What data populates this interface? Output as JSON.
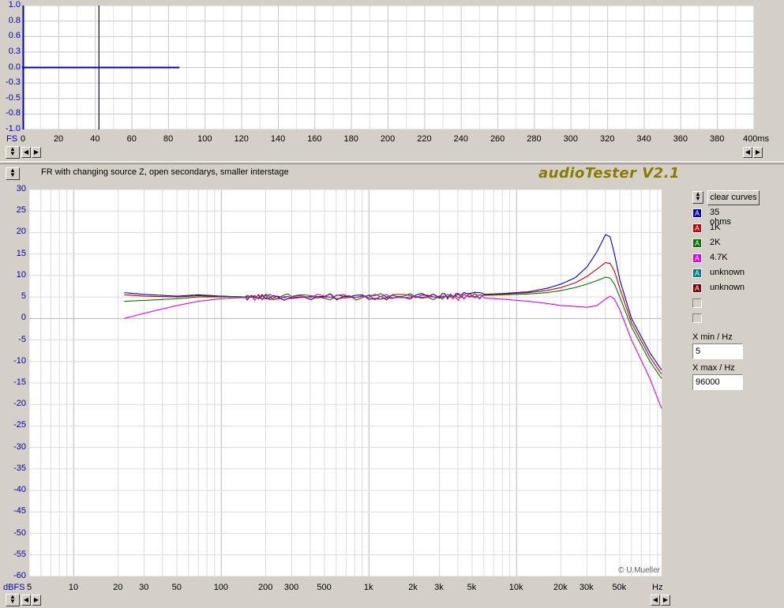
{
  "top_plot": {
    "y_ticks": [
      "1.0",
      "0.8",
      "0.6",
      "0.3",
      "0.0",
      "-0.3",
      "-0.5",
      "-0.8",
      "-1.0"
    ],
    "x_ticks": [
      "0",
      "20",
      "40",
      "60",
      "80",
      "100",
      "120",
      "140",
      "160",
      "180",
      "200",
      "220",
      "240",
      "260",
      "280",
      "300",
      "320",
      "340",
      "360",
      "380",
      "400ms"
    ],
    "y_unit": "FS"
  },
  "graph_title": "FR with changing source Z, open secondarys, smaller interstage",
  "brand": "audioTester V2.1",
  "clear_curves_label": "clear curves",
  "legend": [
    {
      "letter": "A",
      "label": "35 ohms",
      "color": "#0000c8"
    },
    {
      "letter": "A",
      "label": "1K",
      "color": "#c80000"
    },
    {
      "letter": "A",
      "label": "2K",
      "color": "#007800"
    },
    {
      "letter": "A",
      "label": "4.7K",
      "color": "#e000e0"
    },
    {
      "letter": "A",
      "label": "unknown",
      "color": "#008080"
    },
    {
      "letter": "A",
      "label": "unknown",
      "color": "#800000"
    }
  ],
  "xmin_label": "X min / Hz",
  "xmin_value": "5",
  "xmax_label": "X max / Hz",
  "xmax_value": "96000",
  "copyright": "© U.Mueller",
  "chart_data": {
    "type": "line",
    "y_unit": "dBFS",
    "x_unit": "Hz",
    "x_scale": "log",
    "xlim": [
      5,
      96000
    ],
    "ylim": [
      -60,
      30
    ],
    "y_ticks": [
      30,
      25,
      20,
      15,
      10,
      5,
      0,
      -5,
      -10,
      -15,
      -20,
      -25,
      -30,
      -35,
      -40,
      -45,
      -50,
      -55,
      -60
    ],
    "x_tick_labels": [
      {
        "v": 5,
        "t": "5"
      },
      {
        "v": 10,
        "t": "10"
      },
      {
        "v": 20,
        "t": "20"
      },
      {
        "v": 30,
        "t": "30"
      },
      {
        "v": 50,
        "t": "50"
      },
      {
        "v": 100,
        "t": "100"
      },
      {
        "v": 200,
        "t": "200"
      },
      {
        "v": 300,
        "t": "300"
      },
      {
        "v": 500,
        "t": "500"
      },
      {
        "v": 1000,
        "t": "1k"
      },
      {
        "v": 2000,
        "t": "2k"
      },
      {
        "v": 3000,
        "t": "3k"
      },
      {
        "v": 5000,
        "t": "5k"
      },
      {
        "v": 10000,
        "t": "10k"
      },
      {
        "v": 20000,
        "t": "20k"
      },
      {
        "v": 30000,
        "t": "30k"
      },
      {
        "v": 50000,
        "t": "50k"
      }
    ],
    "grid": true,
    "series": [
      {
        "name": "35 ohms",
        "color": "#0000c8",
        "x": [
          22,
          30,
          50,
          70,
          100,
          150,
          300,
          1000,
          3000,
          5000,
          8000,
          12000,
          16000,
          20000,
          25000,
          30000,
          35000,
          40000,
          43000,
          46000,
          50000,
          60000,
          80000,
          96000
        ],
        "y": [
          6,
          5.6,
          5.2,
          5.5,
          5.2,
          5.0,
          5.0,
          5.0,
          5.2,
          5.5,
          5.8,
          6.2,
          7.0,
          8.0,
          9.5,
          12,
          15.5,
          19.5,
          19,
          15,
          9,
          0,
          -8,
          -12
        ]
      },
      {
        "name": "1K",
        "color": "#c80000",
        "x": [
          22,
          30,
          50,
          70,
          100,
          150,
          300,
          1000,
          3000,
          5000,
          8000,
          12000,
          16000,
          20000,
          25000,
          30000,
          35000,
          40000,
          43000,
          46000,
          50000,
          60000,
          80000,
          96000
        ],
        "y": [
          5.5,
          5.2,
          5.0,
          5.3,
          5.1,
          5.0,
          5.0,
          5.0,
          5.2,
          5.4,
          5.7,
          6.0,
          6.5,
          7.2,
          8.3,
          9.8,
          11.5,
          13.0,
          12.8,
          11,
          7,
          -1,
          -9,
          -13
        ]
      },
      {
        "name": "2K",
        "color": "#007800",
        "x": [
          22,
          30,
          50,
          70,
          100,
          150,
          300,
          1000,
          3000,
          5000,
          8000,
          12000,
          16000,
          20000,
          25000,
          30000,
          35000,
          40000,
          43000,
          46000,
          50000,
          60000,
          80000,
          96000
        ],
        "y": [
          4,
          4.2,
          4.6,
          5.0,
          5.0,
          5.0,
          5.0,
          5.0,
          5.1,
          5.3,
          5.5,
          5.7,
          6.0,
          6.5,
          7.2,
          8.0,
          8.8,
          9.6,
          9.4,
          8,
          5,
          -2,
          -10,
          -14
        ]
      },
      {
        "name": "4.7K",
        "color": "#e000e0",
        "x": [
          22,
          30,
          50,
          70,
          100,
          150,
          300,
          1000,
          3000,
          5000,
          8000,
          12000,
          16000,
          20000,
          25000,
          30000,
          35000,
          40000,
          43000,
          46000,
          50000,
          60000,
          80000,
          96000
        ],
        "y": [
          0,
          1.2,
          3.0,
          4.0,
          4.6,
          4.9,
          5.0,
          5.0,
          5.0,
          4.9,
          4.5,
          4.0,
          3.5,
          3.0,
          2.8,
          2.6,
          3.0,
          4.5,
          5.2,
          4.5,
          2,
          -5,
          -14,
          -21
        ]
      }
    ]
  }
}
